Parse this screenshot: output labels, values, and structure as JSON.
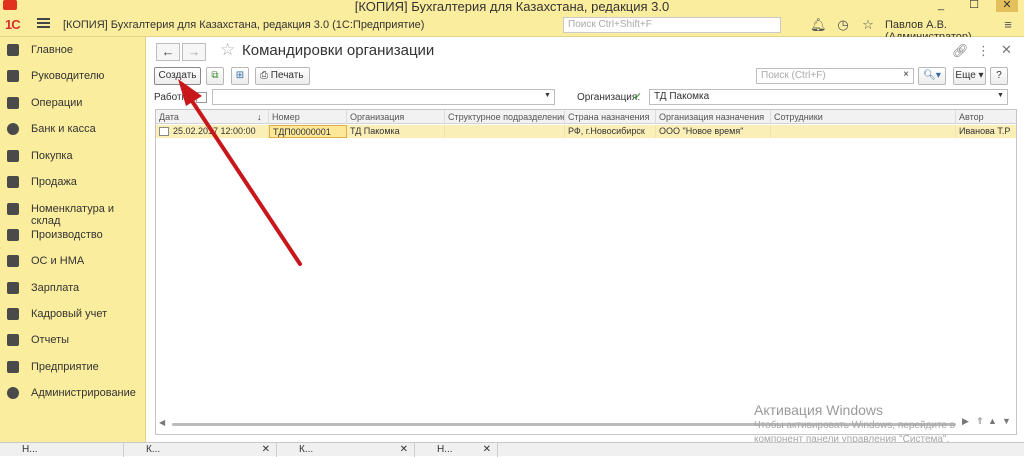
{
  "window": {
    "title": "[КОПИЯ] Бухгалтерия для Казахстана, редакция 3.0",
    "minimize": "_",
    "maximize": "☐",
    "close": "✕"
  },
  "toolbar": {
    "logo": "1С",
    "app_title": "[КОПИЯ] Бухгалтерия для Казахстана, редакция 3.0  (1С:Предприятие)",
    "search_placeholder": "Поиск Ctrl+Shift+F",
    "user": "Павлов А.В. (Администратор)"
  },
  "sidebar": {
    "items": [
      {
        "label": "Главное",
        "icon": "list-icon"
      },
      {
        "label": "Руководителю",
        "icon": "chart-line-icon"
      },
      {
        "label": "Операции",
        "icon": "operations-icon"
      },
      {
        "label": "Банк и касса",
        "icon": "coin-icon"
      },
      {
        "label": "Покупка",
        "icon": "cart-icon"
      },
      {
        "label": "Продажа",
        "icon": "bag-icon"
      },
      {
        "label": "Номенклатура и склад",
        "icon": "warehouse-icon"
      },
      {
        "label": "Производство",
        "icon": "factory-icon"
      },
      {
        "label": "ОС и НМА",
        "icon": "truck-icon"
      },
      {
        "label": "Зарплата",
        "icon": "wallet-icon"
      },
      {
        "label": "Кадровый учет",
        "icon": "people-icon"
      },
      {
        "label": "Отчеты",
        "icon": "report-icon"
      },
      {
        "label": "Предприятие",
        "icon": "building-icon"
      },
      {
        "label": "Администрирование",
        "icon": "gear-icon"
      }
    ]
  },
  "form": {
    "title": "Командировки организации",
    "create_label": "Создать",
    "print_label": "Печать",
    "search_placeholder": "Поиск (Ctrl+F)",
    "more_label": "Еще",
    "help_label": "?",
    "worker_label": "Работник:",
    "organization_label": "Организация:",
    "organization_value": "ТД Пакомка"
  },
  "table": {
    "columns": [
      "Дата",
      "Номер",
      "Организация",
      "Структурное подразделение",
      "Страна назначения",
      "Организация назначения",
      "Сотрудники",
      "Автор"
    ],
    "rows": [
      [
        "25.02.2017 12:00:00",
        "ТДП00000001",
        "ТД Пакомка",
        "",
        "РФ, г.Новосибирск",
        "ООО \"Новое время\"",
        "",
        "Иванова Т.Р"
      ]
    ]
  },
  "watermark": {
    "line1": "Активация Windows",
    "line2": "Чтобы активировать Windows, перейдите в",
    "line3": "компонент панели управления \"Система\"."
  },
  "taskbar": {
    "tabs": [
      "Н...",
      "К...",
      "К...",
      "Н..."
    ]
  }
}
